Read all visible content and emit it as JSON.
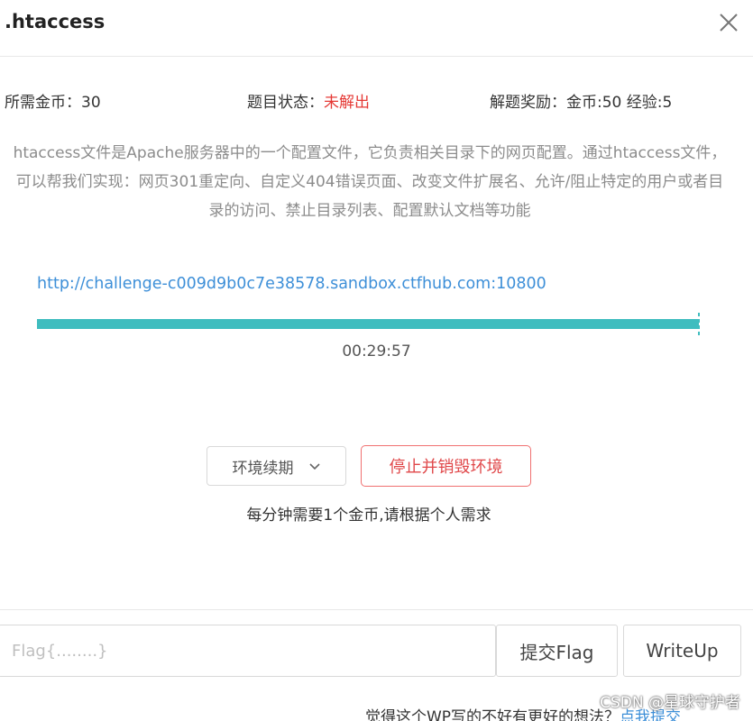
{
  "dialog": {
    "title": ".htaccess",
    "close_icon": "close-icon"
  },
  "info": {
    "coins_required": "所需金币：30",
    "status_label": "题目状态：",
    "status_value": "未解出",
    "status_color": "#e53935",
    "reward": "解题奖励：金币:50 经验:5"
  },
  "description": "htaccess文件是Apache服务器中的一个配置文件，它负责相关目录下的网页配置。通过htaccess文件，可以帮我们实现：网页301重定向、自定义404错误页面、改变文件扩展名、允许/阻止特定的用户或者目录的访问、禁止目录列表、配置默认文档等功能",
  "environment": {
    "url": "http://challenge-c009d9b0c7e38578.sandbox.ctfhub.com:10800",
    "progress_percent": 100,
    "progress_color": "#3fbdbf",
    "timer": "00:29:57"
  },
  "controls": {
    "renew_label": "环境续期",
    "chevron_icon": "chevron-down-icon",
    "stop_label": "停止并销毁环境",
    "cost_note": "每分钟需要1个金币,请根据个人需求"
  },
  "flag": {
    "placeholder": "Flag{........}",
    "value": "",
    "submit_label": "提交Flag",
    "writeup_label": "WriteUp"
  },
  "footer": {
    "feedback_text": "觉得这个WP写的不好有更好的想法？",
    "feedback_link": "点我提交",
    "watermark": "CSDN @星球守护者"
  }
}
